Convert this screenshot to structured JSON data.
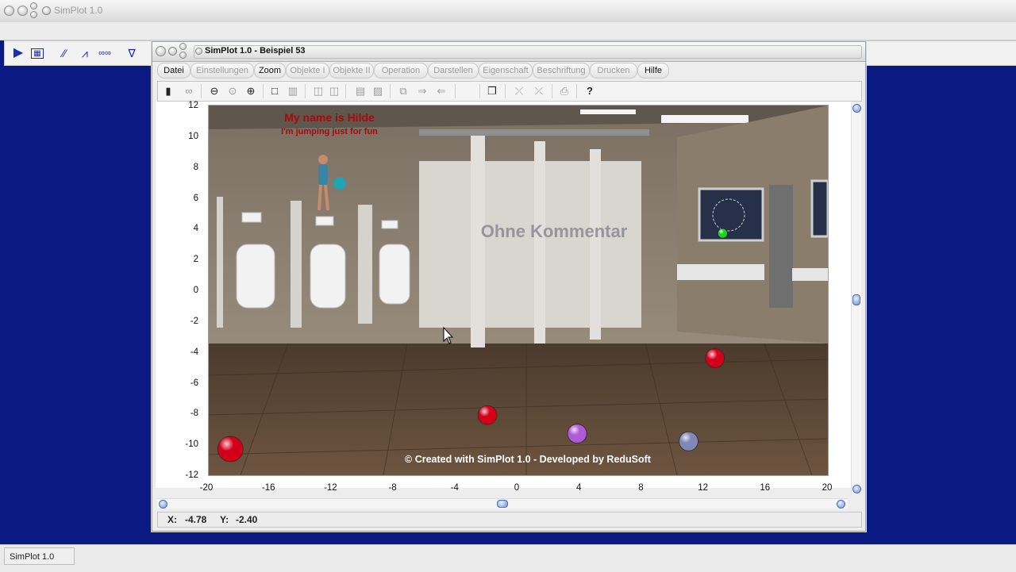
{
  "outer": {
    "title": "SimPlot 1.0",
    "status": "SimPlot 1.0",
    "toolbar_icons": [
      "play-icon",
      "calculator-icon",
      "line-chart-icon",
      "line-chart-2-icon",
      "oscillator-icon",
      "filter-icon"
    ]
  },
  "window": {
    "title": "SimPlot 1.0 - Beispiel 53"
  },
  "menu": [
    {
      "label": "Datei",
      "active": true
    },
    {
      "label": "Einstellungen",
      "active": false
    },
    {
      "label": "Zoom",
      "active": true
    },
    {
      "label": "Objekte I",
      "active": false
    },
    {
      "label": "Objekte II",
      "active": false
    },
    {
      "label": "Operation",
      "active": false
    },
    {
      "label": "Darstellen",
      "active": false
    },
    {
      "label": "Eigenschaft",
      "active": false
    },
    {
      "label": "Beschriftung",
      "active": false
    },
    {
      "label": "Drucken",
      "active": false
    },
    {
      "label": "Hilfe",
      "active": true
    }
  ],
  "plot": {
    "y_ticks": [
      "12",
      "10",
      "8",
      "6",
      "4",
      "2",
      "0",
      "-2",
      "-4",
      "-6",
      "-8",
      "-10",
      "-12"
    ],
    "x_ticks": [
      "-20",
      "-16",
      "-12",
      "-8",
      "-4",
      "0",
      "4",
      "8",
      "12",
      "16",
      "20"
    ],
    "xlim": [
      -20,
      20
    ],
    "ylim": [
      -12,
      12
    ],
    "headline": "My name is Hilde",
    "subline": "I'm jumping just for fun",
    "watermark": "Ohne Kommentar",
    "credit": "© Created with SimPlot 1.0 - Developed by ReduSoft",
    "balls": [
      {
        "x": -18.6,
        "y": -10.3,
        "color": "#d4001a"
      },
      {
        "x": -2.0,
        "y": -8.1,
        "color": "#d4001a"
      },
      {
        "x": 12.7,
        "y": -4.4,
        "color": "#d4001a"
      },
      {
        "x": 3.8,
        "y": -9.3,
        "color": "#b15ad9"
      },
      {
        "x": 11.0,
        "y": -9.8,
        "color": "#8088b8"
      },
      {
        "x": 13.2,
        "y": 3.7,
        "color": "#1bd41b"
      }
    ]
  },
  "coords": {
    "x_label": "X:",
    "x_value": "-4.78",
    "y_label": "Y:",
    "y_value": "-2.40"
  }
}
